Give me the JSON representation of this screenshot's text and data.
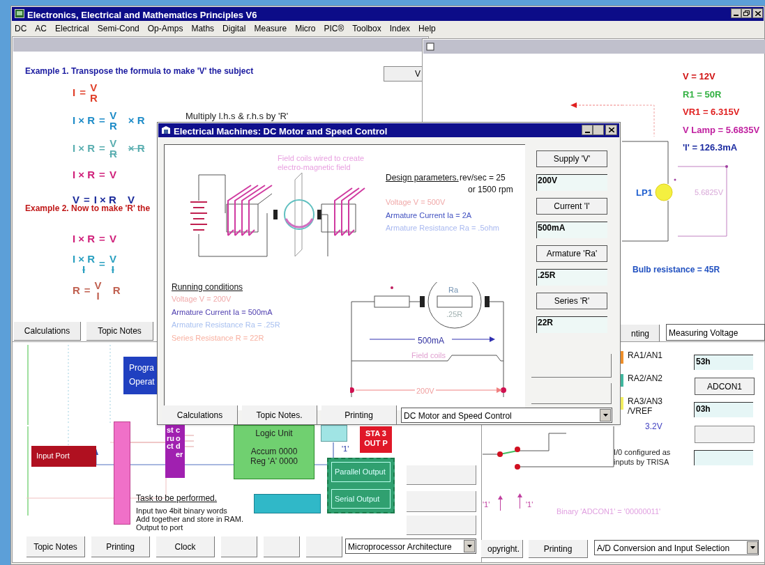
{
  "app": {
    "title": "Electronics, Electrical and Mathematics Principles V6"
  },
  "menu": [
    "DC",
    "AC",
    "Electrical",
    "Semi-Cond",
    "Op-Amps",
    "Maths",
    "Digital",
    "Measure",
    "Micro",
    "PIC®",
    "Toolbox",
    "Index",
    "Help"
  ],
  "transpose_window": {
    "example_1": "Example 1. Transpose the formula to make 'V' the subject",
    "side_button": "V",
    "note": "Multiply l.h.s & r.h.s by 'R'",
    "example_2": "Example 2. Now to make 'R' the",
    "steps_1": [
      {
        "left": "I",
        "sign": "=",
        "right": {
          "num": "V",
          "den": "R"
        },
        "color": "#e0402a",
        "cancelled": false
      },
      {
        "left": "I × R",
        "sign": "=",
        "right": {
          "num": "V",
          "den": "R"
        },
        "tail": "× R",
        "color": "#1e8cc8",
        "cancelled": false
      },
      {
        "left": "I × R",
        "sign": "=",
        "right": {
          "num": "V",
          "den": "R"
        },
        "tail": "× R",
        "color": "#5aaeb0",
        "cancelled": true
      },
      {
        "left": "I × R",
        "sign": "=",
        "right": "V",
        "color": "#d0207a",
        "cancelled": false
      },
      {
        "left": "V",
        "sign": "=",
        "right": "I × R",
        "tail": "V",
        "color": "#1a2a9a",
        "cancelled": false
      }
    ],
    "steps_2": [
      {
        "left": "I × R",
        "sign": "=",
        "right": "V",
        "color": "#d0207a",
        "cancelled": false
      },
      {
        "left": {
          "num": "I × R",
          "den": "I"
        },
        "sign": "=",
        "right": {
          "num": "V",
          "den": "I"
        },
        "color": "#2aa0c0",
        "cancelled": true
      },
      {
        "left": "R",
        "sign": "=",
        "right": {
          "num": "V",
          "den": "I"
        },
        "tail": "R",
        "color": "#c06050",
        "cancelled": false
      }
    ],
    "tabs": [
      "Calculations",
      "Topic Notes"
    ]
  },
  "voltage_window": {
    "readings": [
      "V = 12V",
      "R1 = 50R",
      "VR1 = 6.315V",
      "V Lamp = 5.6835V",
      "'I' = 126.3mA"
    ],
    "lamp_label": "LP1",
    "lamp_voltage": "5.6825V",
    "bulb_resistance": "Bulb resistance = 45R",
    "tab": "nting",
    "dropdown": "Measuring Voltage"
  },
  "micro_window": {
    "program_block": [
      "Progra",
      "Operat"
    ],
    "input_port": "Input Port",
    "decoder": [
      "struct",
      "coder"
    ],
    "alu": [
      "Logic Unit",
      "Accum 0000",
      "Reg 'A' 0000"
    ],
    "status_block": [
      "STA 3",
      "OUT P"
    ],
    "flag": "'1'",
    "outputs": [
      "Parallel Output",
      "Serial Output"
    ],
    "task_title": "Task to be performed.",
    "task_lines": [
      "Input two 4bit binary words",
      "Add together and store in RAM.",
      "Output to port"
    ],
    "buttons": [
      "Topic Notes",
      "Printing",
      "Clock"
    ],
    "dropdown": "Microprocessor Architecture"
  },
  "adc_window": {
    "pins": [
      {
        "label": "RA1/AN1",
        "color": "#f0902a"
      },
      {
        "label": "RA2/AN2",
        "color": "#40b8a0"
      },
      {
        "label": "RA3/AN3\n/VREF",
        "color": "#f4f060"
      }
    ],
    "pin_voltage": "3.2V",
    "fields": [
      "53h",
      "03h"
    ],
    "button": "ADCON1",
    "io_note": "I/0 configured as inputs by TRISA",
    "flags": [
      "'1'",
      "'1'"
    ],
    "binary": "Binary 'ADCON1' = '00000011'",
    "tabs": [
      "opyright.",
      "Printing"
    ],
    "dropdown": "A/D Conversion and Input Selection"
  },
  "motor_dialog": {
    "title": "Electrical Machines: DC Motor and Speed Control",
    "coil_note": "Field coils wired to create\nelectro-magnetic field",
    "design_title": "Design parameters.",
    "rev": "rev/sec = 25",
    "rpm": "or 1500 rpm",
    "design_lines": [
      {
        "text": "Voltage V = 500V",
        "color": "#f0a8a8"
      },
      {
        "text": "Armature Current Ia = 2A",
        "color": "#4050c0"
      },
      {
        "text": "Armature Resistance Ra = .5ohm",
        "color": "#a8b8f0"
      }
    ],
    "running_title": "Running conditions",
    "running_lines": [
      {
        "text": "Voltage V = 200V",
        "color": "#f0a8a8"
      },
      {
        "text": "Armature Current Ia = 500mA",
        "color": "#5040b0"
      },
      {
        "text": "Armature Resistance Ra = .25R",
        "color": "#a8c0f0"
      },
      {
        "text": "Series Resistance R = 22R",
        "color": "#f8b0a0"
      }
    ],
    "circuit": {
      "ra": "Ra",
      "ra_value": ".25R",
      "current": "500mA",
      "field": "Field coils",
      "supply": "200V"
    },
    "controls": [
      {
        "button": "Supply 'V'",
        "value": "200V"
      },
      {
        "button": "Current 'I'",
        "value": "500mA"
      },
      {
        "button": "Armature 'Ra'",
        "value": ".25R"
      },
      {
        "button": "Series 'R'",
        "value": "22R"
      }
    ],
    "tabs": [
      "Calculations",
      "Topic Notes.",
      "Printing"
    ],
    "dropdown": "DC Motor and Speed Control"
  }
}
